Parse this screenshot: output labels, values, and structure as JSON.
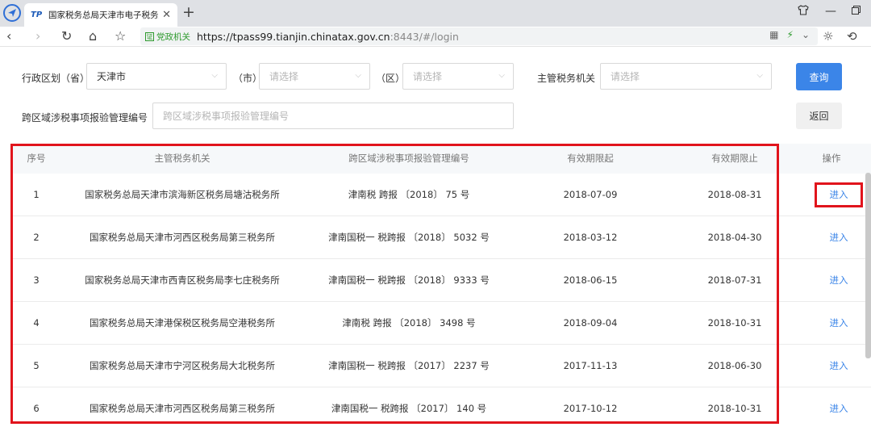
{
  "browser": {
    "tab_title": "国家税务总局天津市电子税务局",
    "tab_favicon": "TP",
    "url_badge": "党政机关",
    "url_host": "https://tpass99.tianjin.chinatax.gov.cn",
    "url_rest": ":8443/#/login"
  },
  "filters": {
    "region_label": "行政区划（省）",
    "province_value": "天津市",
    "city_label": "（市）",
    "city_placeholder": "请选择",
    "district_label": "（区）",
    "district_placeholder": "请选择",
    "tax_office_label": "主管税务机关",
    "tax_office_placeholder": "请选择",
    "code_label": "跨区域涉税事项报验管理编号",
    "code_placeholder": "跨区域涉税事项报验管理编号",
    "query_button": "查询",
    "back_button": "返回"
  },
  "table": {
    "headers": [
      "序号",
      "主管税务机关",
      "跨区域涉税事项报验管理编号",
      "有效期限起",
      "有效期限止",
      "操作"
    ],
    "rows": [
      {
        "no": "1",
        "office": "国家税务总局天津市滨海新区税务局塘沽税务所",
        "code": "津南税 跨报 〔2018〕 75 号",
        "start": "2018-07-09",
        "end": "2018-08-31",
        "action": "进入"
      },
      {
        "no": "2",
        "office": "国家税务总局天津市河西区税务局第三税务所",
        "code": "津南国税一 税跨报 〔2018〕 5032 号",
        "start": "2018-03-12",
        "end": "2018-04-30",
        "action": "进入"
      },
      {
        "no": "3",
        "office": "国家税务总局天津市西青区税务局李七庄税务所",
        "code": "津南国税一 税跨报 〔2018〕 9333 号",
        "start": "2018-06-15",
        "end": "2018-07-31",
        "action": "进入"
      },
      {
        "no": "4",
        "office": "国家税务总局天津港保税区税务局空港税务所",
        "code": "津南税 跨报 〔2018〕 3498 号",
        "start": "2018-09-04",
        "end": "2018-10-31",
        "action": "进入"
      },
      {
        "no": "5",
        "office": "国家税务总局天津市宁河区税务局大北税务所",
        "code": "津南国税一 税跨报 〔2017〕 2237 号",
        "start": "2017-11-13",
        "end": "2018-06-30",
        "action": "进入"
      },
      {
        "no": "6",
        "office": "国家税务总局天津市河西区税务局第三税务所",
        "code": "津南国税一 税跨报 〔2017〕 140 号",
        "start": "2017-10-12",
        "end": "2018-10-31",
        "action": "进入"
      }
    ]
  },
  "colors": {
    "primary": "#3b85e8",
    "highlight_red": "#e1141c"
  }
}
